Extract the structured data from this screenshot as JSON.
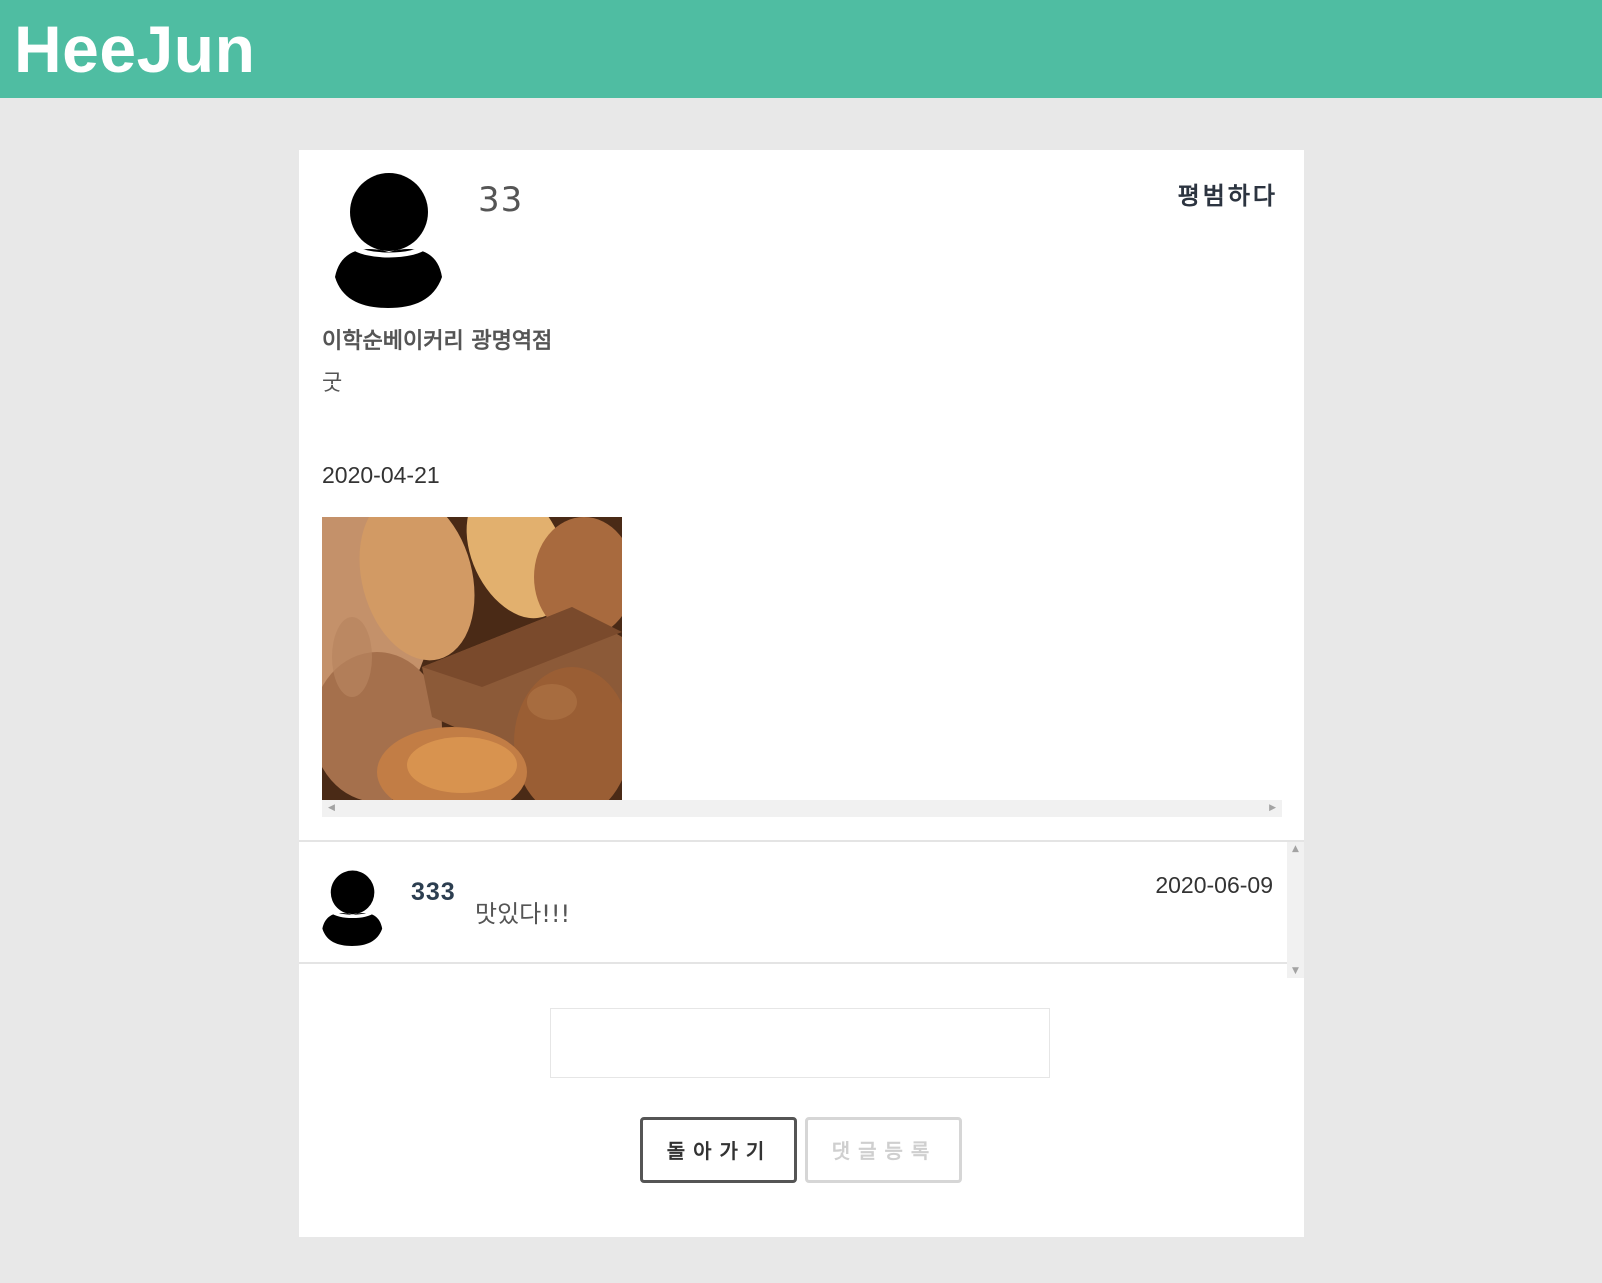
{
  "header": {
    "brand": "HeeJun"
  },
  "review": {
    "author": "33",
    "rating_text": "평범하다",
    "store_name": "이학순베이커리 광명역점",
    "content": "굿",
    "date": "2020-04-21",
    "photo": "bread-photo"
  },
  "comments": [
    {
      "author": "333",
      "text": "맛있다!!!",
      "date": "2020-06-09"
    }
  ],
  "comment_form": {
    "input_value": "",
    "back_label": "돌아가기",
    "submit_label": "댓글등록"
  },
  "colors": {
    "header_bg": "#4fbda2",
    "page_bg": "#e8e8e8",
    "card_bg": "#ffffff"
  }
}
